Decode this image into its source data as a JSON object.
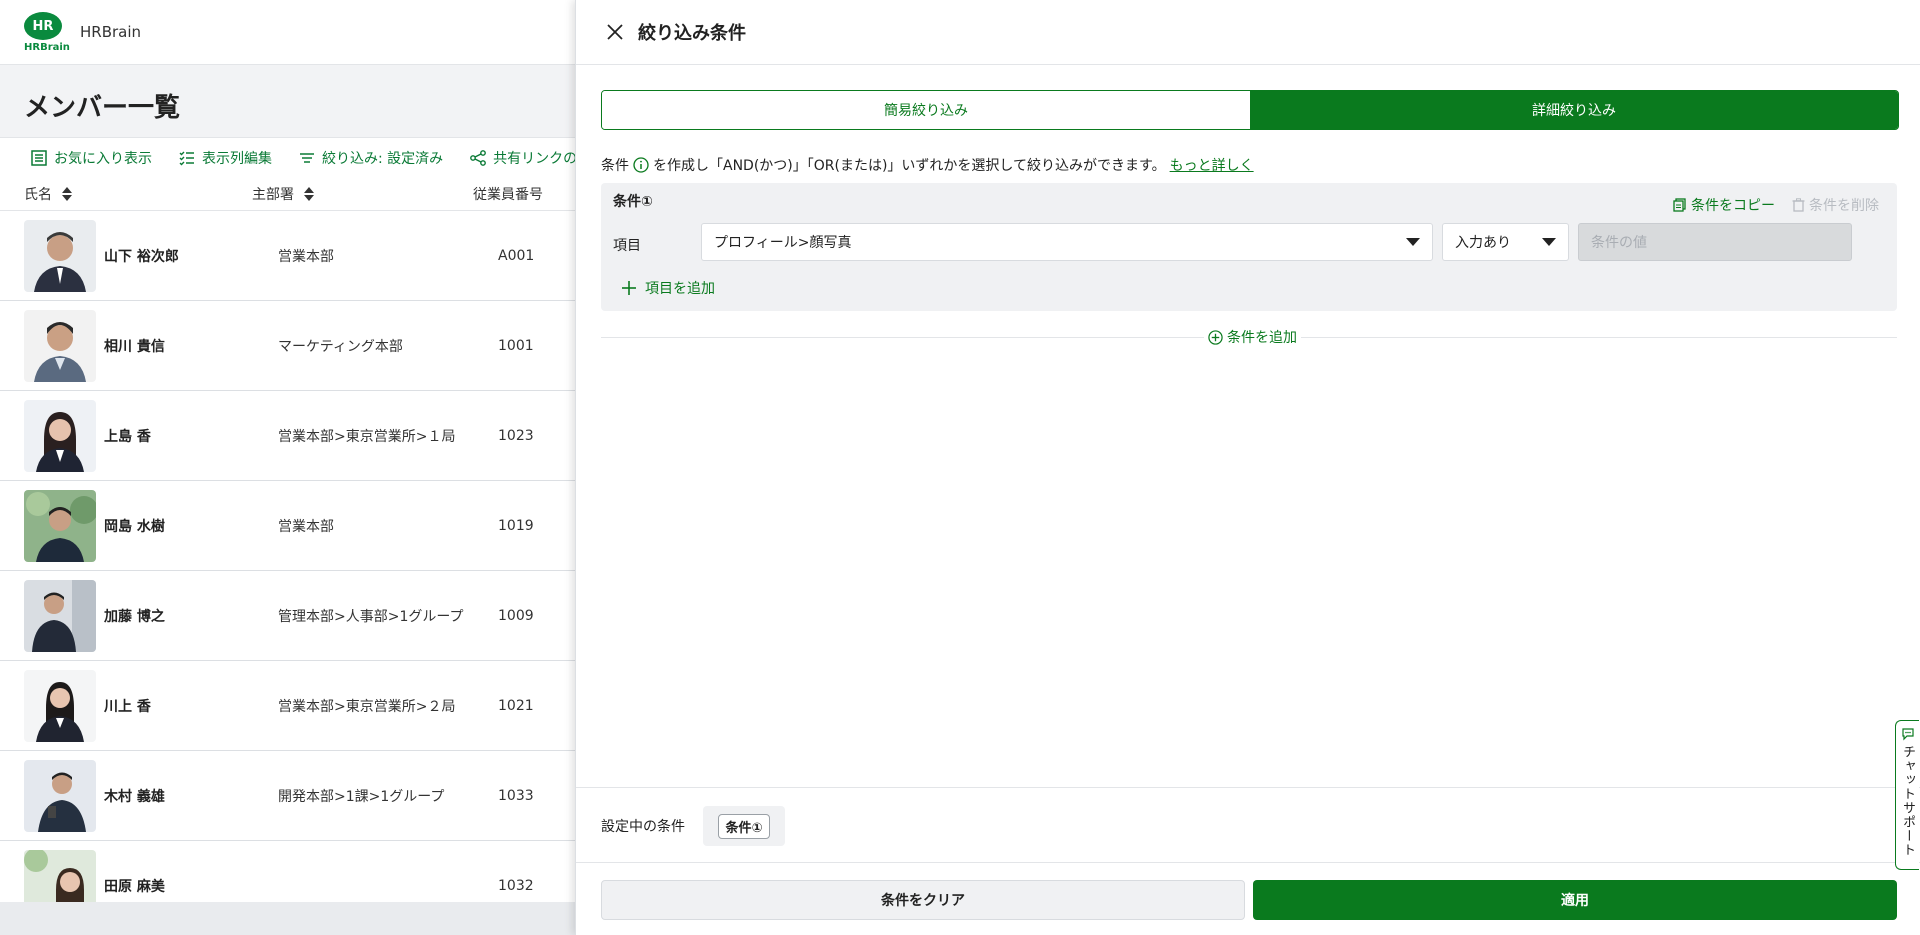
{
  "app": {
    "logo_mark": "HR",
    "logo_text": "HRBrain",
    "brand": "HRBrain",
    "page_title": "メンバー一覧",
    "toolbar": {
      "favorites": "お気に入り表示",
      "columns": "表示列編集",
      "filter": "絞り込み: 設定済み",
      "share": "共有リンクの発行"
    },
    "columns": {
      "name": "氏名",
      "dept": "主部署",
      "id": "従業員番号"
    },
    "rows": [
      {
        "name": "山下 裕次郎",
        "dept": "営業本部",
        "id": "A001"
      },
      {
        "name": "相川 貴信",
        "dept": "マーケティング本部",
        "id": "1001"
      },
      {
        "name": "上島 香",
        "dept": "営業本部>東京営業所>１局",
        "id": "1023"
      },
      {
        "name": "岡島 水樹",
        "dept": "営業本部",
        "id": "1019"
      },
      {
        "name": "加藤 博之",
        "dept": "管理本部>人事部>1グループ",
        "id": "1009"
      },
      {
        "name": "川上 香",
        "dept": "営業本部>東京営業所>２局",
        "id": "1021"
      },
      {
        "name": "木村 義雄",
        "dept": "開発本部>1課>1グループ",
        "id": "1033"
      },
      {
        "name": "田原 麻美",
        "dept": "",
        "id": "1032"
      }
    ]
  },
  "drawer": {
    "title": "絞り込み条件",
    "tabs": {
      "simple": "簡易絞り込み",
      "advanced": "詳細絞り込み"
    },
    "desc_prefix": "条件",
    "desc_body": "を作成し「AND(かつ)」「OR(または)」いずれかを選択して絞り込みができます。",
    "desc_link": "もっと詳しく",
    "condition": {
      "label": "条件①",
      "copy": "条件をコピー",
      "delete": "条件を削除",
      "item_label": "項目",
      "field_value": "プロフィール>顔写真",
      "operator_value": "入力あり",
      "value_placeholder": "条件の値",
      "add_item": "項目を追加"
    },
    "add_condition": "条件を追加",
    "current_label": "設定中の条件",
    "current_chip": "条件①",
    "clear": "条件をクリア",
    "apply": "適用",
    "chat": "チャットサポート"
  },
  "colors": {
    "accent": "#0a7a1e",
    "brand": "#0a8a3e"
  }
}
